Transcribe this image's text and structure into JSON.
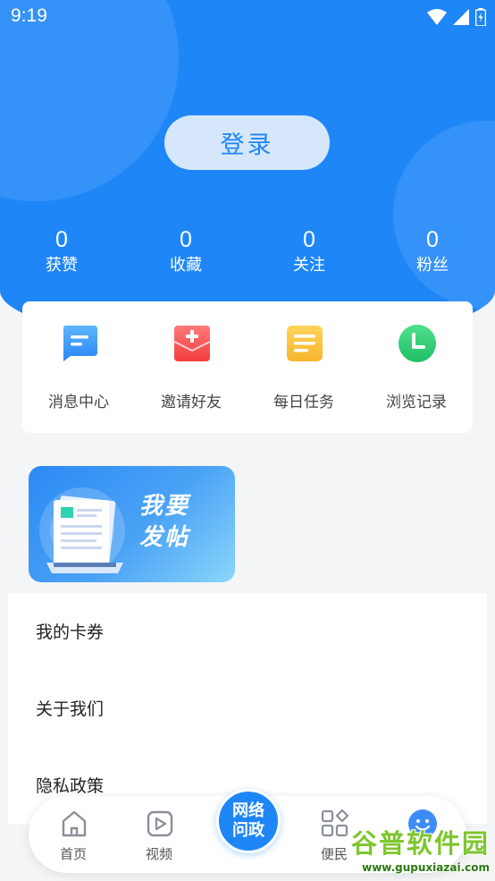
{
  "status_bar": {
    "time": "9:19"
  },
  "login": {
    "label": "登录"
  },
  "stats": [
    {
      "value": "0",
      "label": "获赞"
    },
    {
      "value": "0",
      "label": "收藏"
    },
    {
      "value": "0",
      "label": "关注"
    },
    {
      "value": "0",
      "label": "粉丝"
    }
  ],
  "menu": [
    {
      "label": "消息中心",
      "icon": "message-center-icon"
    },
    {
      "label": "邀请好友",
      "icon": "invite-envelope-icon"
    },
    {
      "label": "每日任务",
      "icon": "daily-task-icon"
    },
    {
      "label": "浏览记录",
      "icon": "history-clock-icon"
    }
  ],
  "post_banner": {
    "line1": "我要",
    "line2": "发帖"
  },
  "list": [
    {
      "label": "我的卡券"
    },
    {
      "label": "关于我们"
    },
    {
      "label": "隐私政策"
    }
  ],
  "bottom_nav": {
    "home": "首页",
    "video": "视频",
    "center": "网络\n问政",
    "services": "便民",
    "mine": ""
  },
  "watermark": {
    "main": "谷普软件园",
    "sub": "www.gupuxiazai.com"
  },
  "colors": {
    "primary": "#1f86f8",
    "background": "#f4f5f7",
    "login_bg": "#d6e7fb"
  }
}
